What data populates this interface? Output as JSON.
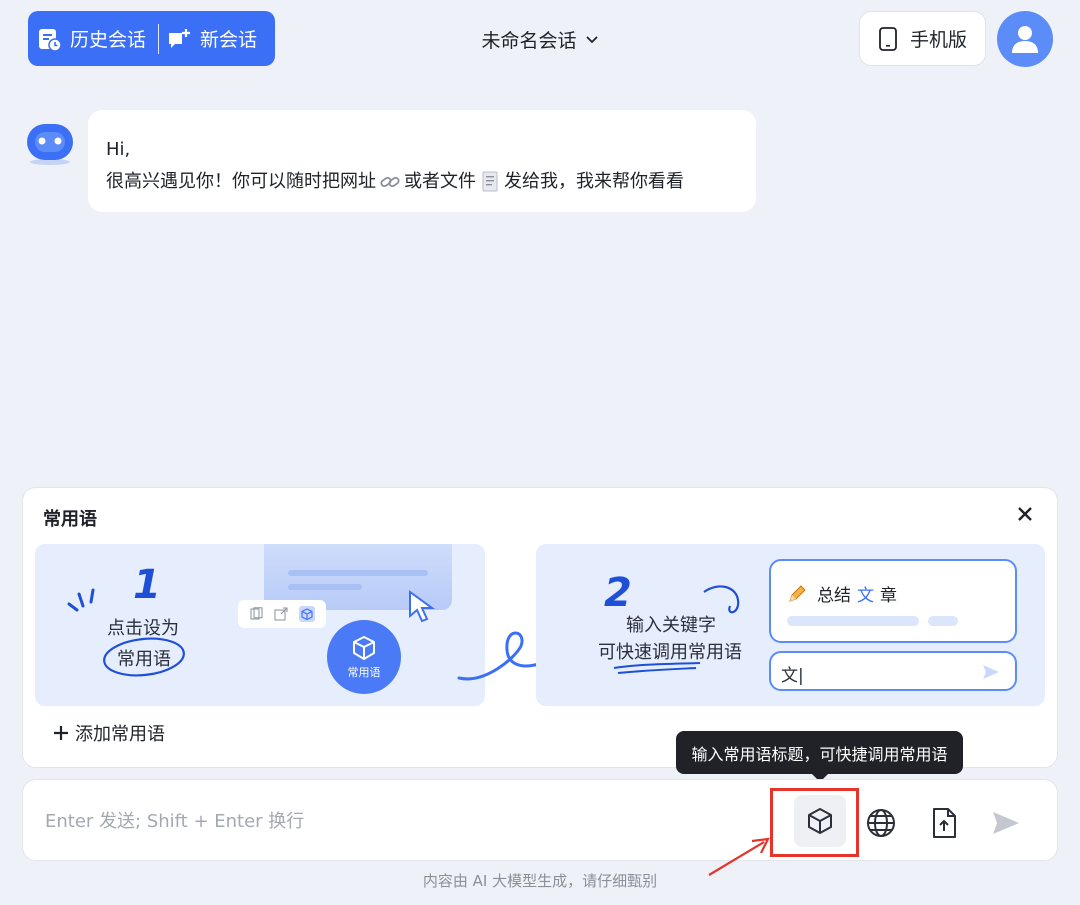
{
  "header": {
    "history_label": "历史会话",
    "new_label": "新会话",
    "conversation_title": "未命名会话",
    "mobile_label": "手机版"
  },
  "chat": {
    "greeting": "Hi,",
    "message_part1": "很高兴遇见你！你可以随时把网址",
    "message_part2": "或者文件",
    "message_part3": "发给我，我来帮你看看"
  },
  "phrases_panel": {
    "title": "常用语",
    "step1_number": "1",
    "step1_line1": "点击设为",
    "step1_line2": "常用语",
    "step1_button": "常用语",
    "step2_number": "2",
    "step2_line1": "输入关键字",
    "step2_line2": "可快速调用常用语",
    "step2_card_pre": "总结",
    "step2_card_accent": "文",
    "step2_card_post": "章",
    "step2_input": "文|",
    "add_label": "添加常用语"
  },
  "tooltip": "输入常用语标题，可快捷调用常用语",
  "input": {
    "placeholder": "Enter 发送; Shift + Enter 换行"
  },
  "footer": "内容由 AI 大模型生成，请仔细甄别",
  "colors": {
    "accent": "#3b6ff5",
    "background": "#eff1f9",
    "highlight_box": "#e53429",
    "tooltip_bg": "#202227"
  }
}
